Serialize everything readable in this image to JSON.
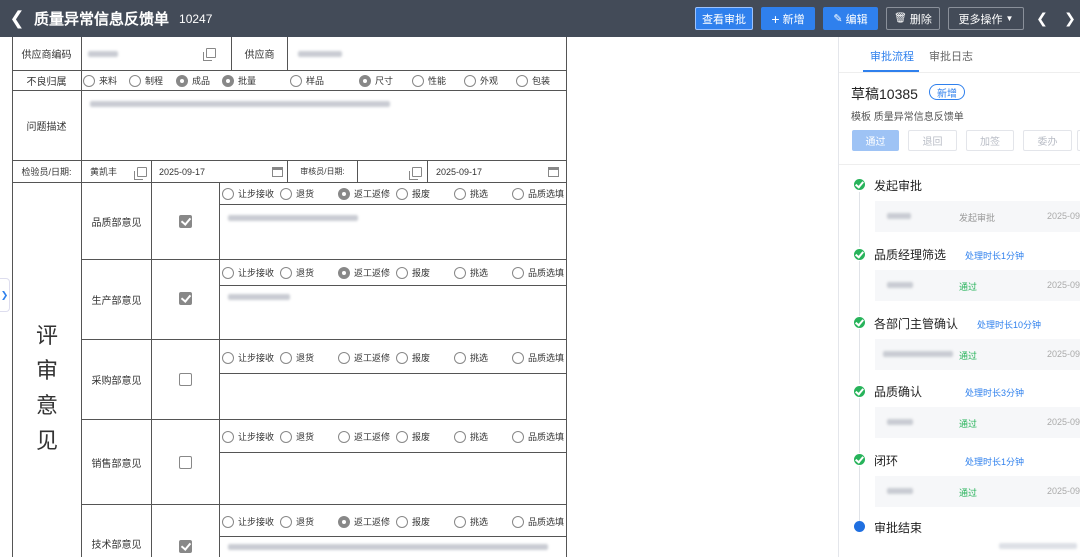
{
  "header": {
    "title": "质量异常信息反馈单",
    "form_id": "10247",
    "buttons": {
      "view_approval": "查看审批",
      "add": "新增",
      "edit": "编辑",
      "delete": "删除",
      "more": "更多操作"
    }
  },
  "form": {
    "supplier_code_label": "供应商编码",
    "supplier_label": "供应商",
    "defect_label": "不良归属",
    "defect_options": [
      "来料",
      "制程",
      "成品"
    ],
    "defect_selected": "成品",
    "batch_options": [
      "批量",
      "样品"
    ],
    "batch_selected": "批量",
    "type_options": [
      "尺寸",
      "性能",
      "外观",
      "包装"
    ],
    "type_selected": "尺寸",
    "problem_label": "问题描述",
    "inspector_label": "检验员/日期:",
    "inspector_name": "黄凯丰",
    "inspector_date": "2025-09-17",
    "reviewer_label": "审核员/日期:",
    "reviewer_date": "2025-09-17",
    "review_big_label": [
      "评",
      "审",
      "意",
      "见"
    ],
    "disposition_options": [
      "让步接收",
      "退货",
      "返工返修",
      "报废",
      "挑选",
      "品质选填"
    ],
    "departments": [
      {
        "label": "品质部意见",
        "checked": true,
        "selected": "返工返修"
      },
      {
        "label": "生产部意见",
        "checked": true,
        "selected": "返工返修"
      },
      {
        "label": "采购部意见",
        "checked": false,
        "selected": ""
      },
      {
        "label": "销售部意见",
        "checked": false,
        "selected": ""
      },
      {
        "label": "技术部意见",
        "checked": true,
        "selected": "返工返修"
      }
    ]
  },
  "panel": {
    "tabs": [
      "审批流程",
      "审批日志"
    ],
    "draft_title": "草稿10385",
    "badge": "新增",
    "template": "模板 质量异常信息反馈单",
    "actions": [
      "通过",
      "退回",
      "加签",
      "委办"
    ],
    "steps": [
      {
        "title": "发起审批",
        "duration": "",
        "action": "发起审批",
        "time": "2025-09",
        "action_ok": false
      },
      {
        "title": "品质经理筛选",
        "duration": "处理时长1分钟",
        "action": "通过",
        "time": "2025-09",
        "action_ok": true
      },
      {
        "title": "各部门主管确认",
        "duration": "处理时长10分钟",
        "action": "通过",
        "time": "2025-09",
        "action_ok": true
      },
      {
        "title": "品质确认",
        "duration": "处理时长3分钟",
        "action": "通过",
        "time": "2025-09",
        "action_ok": true
      },
      {
        "title": "闭环",
        "duration": "处理时长1分钟",
        "action": "通过",
        "time": "2025-09",
        "action_ok": true
      }
    ],
    "end_title": "审批结束"
  },
  "colors": {
    "topbar": "#434b58",
    "primary": "#2f80ed",
    "success": "#27b35a"
  }
}
